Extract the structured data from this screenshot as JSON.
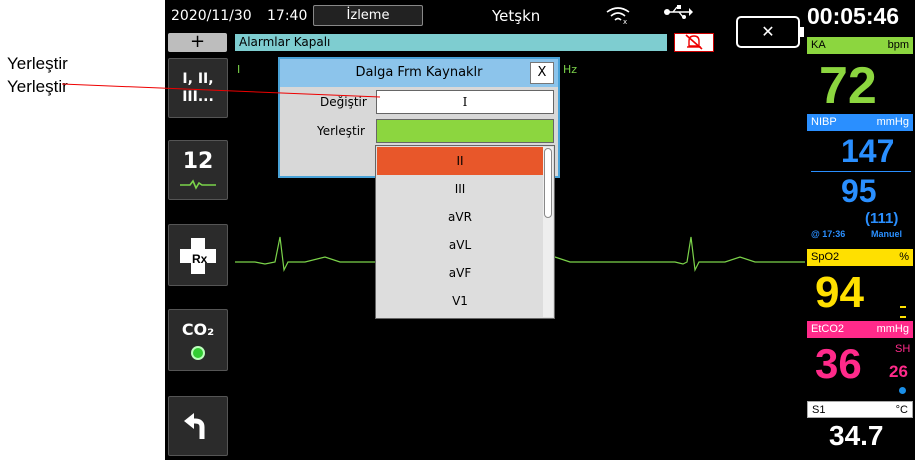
{
  "annotation": {
    "line1": "Yerleştir",
    "line2": "Yerleştir"
  },
  "status": {
    "date": "2020/11/30",
    "time": "17:40",
    "mode": "İzleme",
    "patient_type": "Yetşkn",
    "wifi_icon": "wifi-icon",
    "usb_icon": "usb-icon",
    "battery_icon": "battery-empty-icon",
    "elapsed": "00:05:46"
  },
  "alarm_bar": {
    "text": "Alarmlar Kapalı",
    "plus_label": "+",
    "mute_icon": "alarm-muted-icon"
  },
  "sidebar": {
    "lead_label": "I, II,\nIII...",
    "twelve_lead_label": "12",
    "co2_label": "CO₂",
    "back_icon": "back-arrow-icon",
    "rx_icon": "medical-cross-rx-icon"
  },
  "waveform": {
    "lead_marker": "I",
    "hz_fragment": "Hz"
  },
  "dialog": {
    "title": "Dalga Frm Kaynaklr",
    "close_label": "X",
    "replace_label": "Değiştir",
    "replace_value": "I",
    "place_label": "Yerleştir",
    "place_value": ""
  },
  "dropdown": {
    "options": [
      "II",
      "III",
      "aVR",
      "aVL",
      "aVF",
      "V1"
    ],
    "selected": "II"
  },
  "vitals": {
    "hr": {
      "label": "KA",
      "unit": "bpm",
      "value": "72"
    },
    "nibp": {
      "label": "NIBP",
      "unit": "mmHg",
      "sys": "147",
      "dia": "95",
      "map": "(111)",
      "time": "@ 17:36",
      "mode": "Manuel"
    },
    "spo2": {
      "label": "SpO2",
      "unit": "%",
      "value": "94"
    },
    "etco2": {
      "label": "EtCO2",
      "unit": "mmHg",
      "value": "36",
      "sh_label": "SH",
      "rr": "26"
    },
    "temp": {
      "label": "S1",
      "unit": "°C",
      "value": "34.7"
    }
  },
  "colors": {
    "hr": "#8cd63f",
    "nibp": "#2a8fff",
    "spo2": "#ffe000",
    "etco2": "#ff2a8a",
    "selected_option": "#e8572a",
    "place_field": "#8cd63f"
  }
}
